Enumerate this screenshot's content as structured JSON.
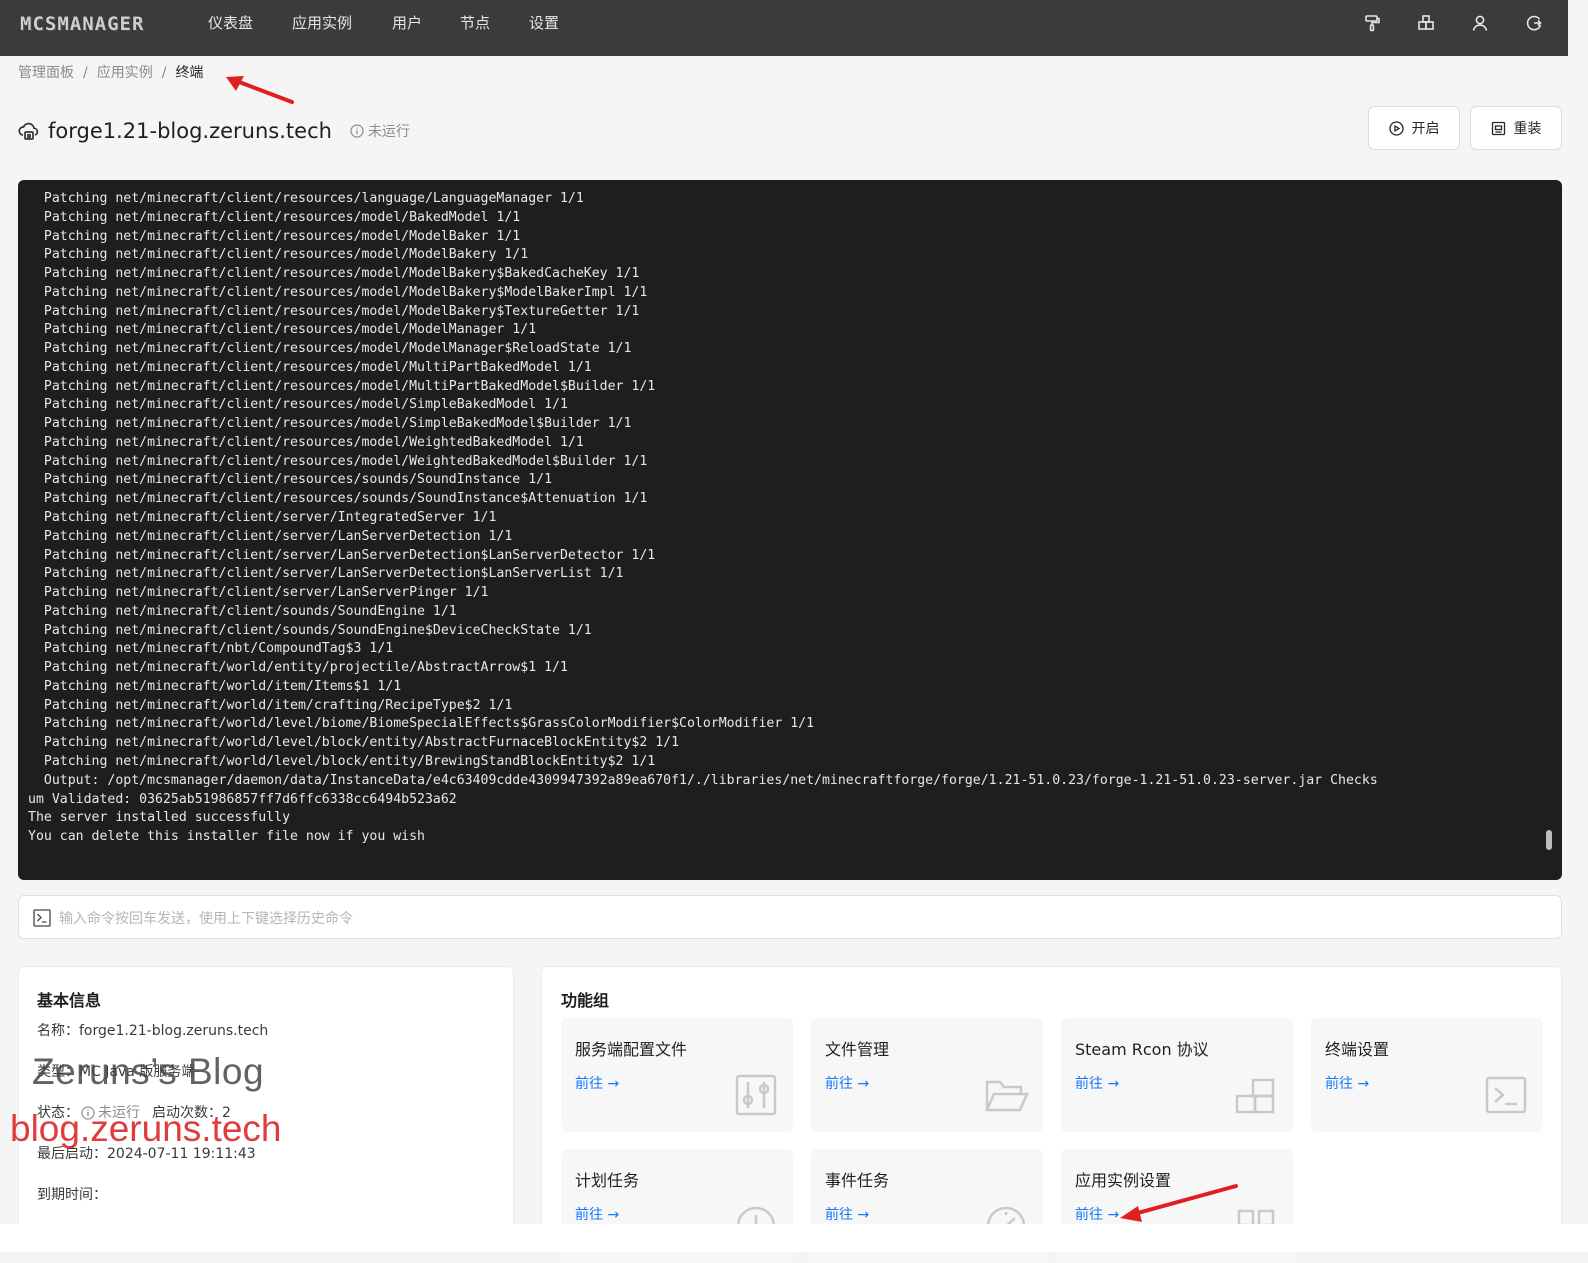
{
  "nav": {
    "logo": "MCSMANAGER",
    "items": [
      "仪表盘",
      "应用实例",
      "用户",
      "节点",
      "设置"
    ],
    "icons": [
      "paint-roller-icon",
      "layout-icon",
      "user-icon",
      "logout-icon"
    ]
  },
  "breadcrumb": {
    "items": [
      "管理面板",
      "应用实例",
      "终端"
    ]
  },
  "instance": {
    "name": "forge1.21-blog.zeruns.tech",
    "status": "未运行"
  },
  "actions": {
    "start_label": "开启",
    "reinstall_label": "重装"
  },
  "terminal": {
    "lines": [
      "  Patching net/minecraft/client/resources/language/LanguageManager 1/1",
      "  Patching net/minecraft/client/resources/model/BakedModel 1/1",
      "  Patching net/minecraft/client/resources/model/ModelBaker 1/1",
      "  Patching net/minecraft/client/resources/model/ModelBakery 1/1",
      "  Patching net/minecraft/client/resources/model/ModelBakery$BakedCacheKey 1/1",
      "  Patching net/minecraft/client/resources/model/ModelBakery$ModelBakerImpl 1/1",
      "  Patching net/minecraft/client/resources/model/ModelBakery$TextureGetter 1/1",
      "  Patching net/minecraft/client/resources/model/ModelManager 1/1",
      "  Patching net/minecraft/client/resources/model/ModelManager$ReloadState 1/1",
      "  Patching net/minecraft/client/resources/model/MultiPartBakedModel 1/1",
      "  Patching net/minecraft/client/resources/model/MultiPartBakedModel$Builder 1/1",
      "  Patching net/minecraft/client/resources/model/SimpleBakedModel 1/1",
      "  Patching net/minecraft/client/resources/model/SimpleBakedModel$Builder 1/1",
      "  Patching net/minecraft/client/resources/model/WeightedBakedModel 1/1",
      "  Patching net/minecraft/client/resources/model/WeightedBakedModel$Builder 1/1",
      "  Patching net/minecraft/client/resources/sounds/SoundInstance 1/1",
      "  Patching net/minecraft/client/resources/sounds/SoundInstance$Attenuation 1/1",
      "  Patching net/minecraft/client/server/IntegratedServer 1/1",
      "  Patching net/minecraft/client/server/LanServerDetection 1/1",
      "  Patching net/minecraft/client/server/LanServerDetection$LanServerDetector 1/1",
      "  Patching net/minecraft/client/server/LanServerDetection$LanServerList 1/1",
      "  Patching net/minecraft/client/server/LanServerPinger 1/1",
      "  Patching net/minecraft/client/sounds/SoundEngine 1/1",
      "  Patching net/minecraft/client/sounds/SoundEngine$DeviceCheckState 1/1",
      "  Patching net/minecraft/nbt/CompoundTag$3 1/1",
      "  Patching net/minecraft/world/entity/projectile/AbstractArrow$1 1/1",
      "  Patching net/minecraft/world/item/Items$1 1/1",
      "  Patching net/minecraft/world/item/crafting/RecipeType$2 1/1",
      "  Patching net/minecraft/world/level/biome/BiomeSpecialEffects$GrassColorModifier$ColorModifier 1/1",
      "  Patching net/minecraft/world/level/block/entity/AbstractFurnaceBlockEntity$2 1/1",
      "  Patching net/minecraft/world/level/block/entity/BrewingStandBlockEntity$2 1/1",
      "  Output: /opt/mcsmanager/daemon/data/InstanceData/e4c63409cdde4309947392a89ea670f1/./libraries/net/minecraftforge/forge/1.21-51.0.23/forge-1.21-51.0.23-server.jar Checks",
      "um Validated: 03625ab51986857ff7d6ffc6338cc6494b523a62",
      "The server installed successfully",
      "You can delete this installer file now if you wish"
    ]
  },
  "command": {
    "placeholder": "输入命令按回车发送，使用上下键选择历史命令"
  },
  "basic_info": {
    "title": "基本信息",
    "name_label": "名称：",
    "name_value": "forge1.21-blog.zeruns.tech",
    "type_label": "类型：",
    "type_value": "MC Java 版服务端",
    "status_label": "状态：",
    "status_value": "未运行",
    "starts_label": "启动次数：",
    "starts_value": "2",
    "last_start_label": "最后启动：",
    "last_start_value": "2024-07-11 19:11:43",
    "expire_label": "到期时间："
  },
  "watermark": {
    "line1": "Zeruns’s Blog",
    "line2": "blog.zeruns.tech"
  },
  "function_group": {
    "title": "功能组",
    "go_label": "前往 →",
    "tiles": [
      {
        "title": "服务端配置文件",
        "icon": "sliders-icon"
      },
      {
        "title": "文件管理",
        "icon": "folder-open-icon"
      },
      {
        "title": "Steam Rcon 协议",
        "icon": "blocks-icon"
      },
      {
        "title": "终端设置",
        "icon": "terminal-icon"
      },
      {
        "title": "计划任务",
        "icon": "clock-icon"
      },
      {
        "title": "事件任务",
        "icon": "gauge-icon"
      },
      {
        "title": "应用实例设置",
        "icon": "grid-icon"
      }
    ]
  },
  "colors": {
    "nav_bg": "#3b3b3b",
    "terminal_bg": "#1e1e1e",
    "link": "#1677ff",
    "annotation_arrow": "#e02020"
  }
}
